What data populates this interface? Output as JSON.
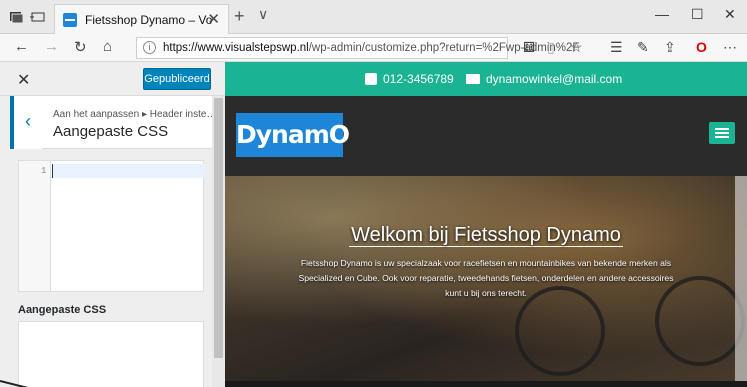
{
  "browser": {
    "tab_title": "Fietsshop Dynamo – Vo",
    "new_tab": "+",
    "tab_list": "∨",
    "minimize": "—",
    "maximize": "☐",
    "close": "✕",
    "url_host": "https://www.visualstepswp.nl",
    "url_path": "/wp-admin/customize.php?return=%2Fwp-admin%2F"
  },
  "customizer": {
    "close_label": "✕",
    "publish_label": "Gepubliceerd",
    "breadcrumb": "Aan het aanpassen ▸ Header inste…",
    "section_title": "Aangepaste CSS",
    "line_number": "1",
    "css_label": "Aangepaste CSS"
  },
  "site": {
    "phone": "012-3456789",
    "email": "dynamowinkel@mail.com",
    "logo": "DynamO",
    "hero_title": "Welkom bij Fietsshop Dynamo",
    "hero_text": "Fietsshop Dynamo is uw specialzaak voor racefietsen en mountainbikes van bekende merken als Specialized en Cube. Ook voor reparatie, tweedehands fietsen, onderdelen en andere accessoires kunt u bij ons terecht.",
    "accent_color": "#1ab394",
    "logo_color": "#1e86d8"
  }
}
